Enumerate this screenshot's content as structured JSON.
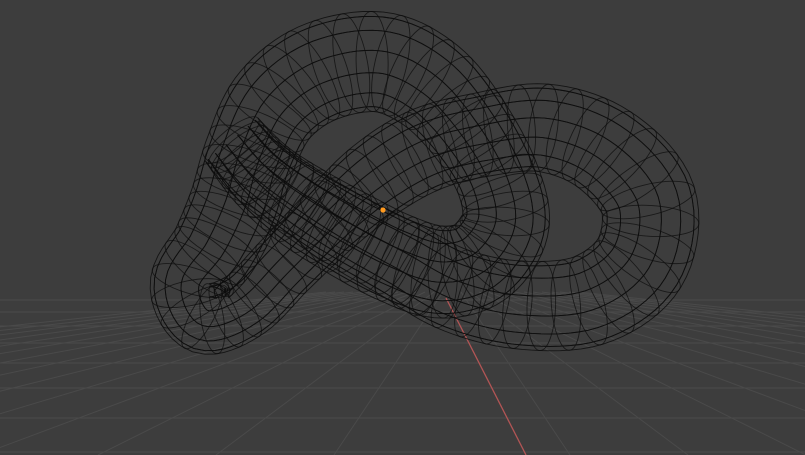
{
  "viewport": {
    "shading_mode": "wireframe",
    "object": "torus-knot",
    "show_floor_grid": true,
    "show_x_axis": true
  },
  "colors": {
    "background": "#3d3d3d",
    "grid_line": "#4a4a4a",
    "x_axis": "#b25555",
    "wire": "#0d0d0d",
    "origin_point": "#ff9a1f"
  }
}
